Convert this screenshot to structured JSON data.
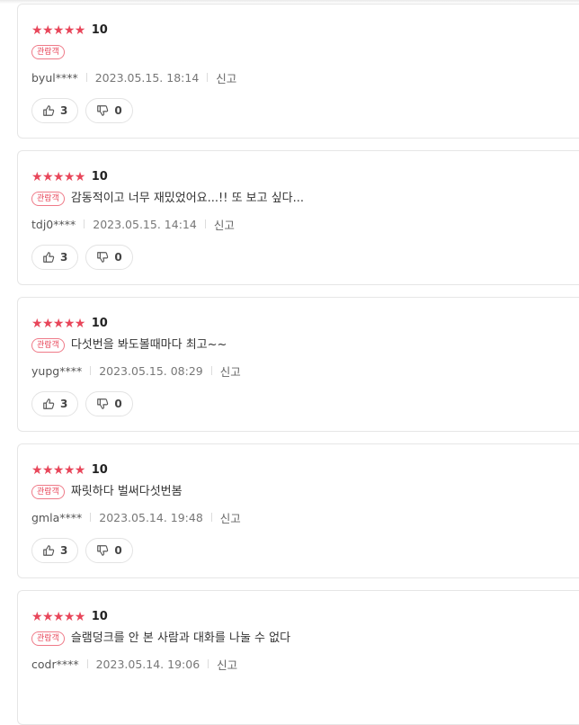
{
  "reviews": [
    {
      "stars": "★★★★★",
      "score": "10",
      "badge": "관람객",
      "comment": "",
      "user": "byul****",
      "date": "2023.05.15. 18:14",
      "report": "신고",
      "likes": "3",
      "dislikes": "0"
    },
    {
      "stars": "★★★★★",
      "score": "10",
      "badge": "관람객",
      "comment": "감동적이고 너무 재밌었어요...!! 또 보고 싶다...",
      "user": "tdj0****",
      "date": "2023.05.15. 14:14",
      "report": "신고",
      "likes": "3",
      "dislikes": "0"
    },
    {
      "stars": "★★★★★",
      "score": "10",
      "badge": "관람객",
      "comment": "다섯번을 봐도볼때마다 최고~~",
      "user": "yupg****",
      "date": "2023.05.15. 08:29",
      "report": "신고",
      "likes": "3",
      "dislikes": "0"
    },
    {
      "stars": "★★★★★",
      "score": "10",
      "badge": "관람객",
      "comment": "짜릿하다 벌써다섯번봄",
      "user": "gmla****",
      "date": "2023.05.14. 19:48",
      "report": "신고",
      "likes": "3",
      "dislikes": "0"
    },
    {
      "stars": "★★★★★",
      "score": "10",
      "badge": "관람객",
      "comment": "슬램덩크를 안 본 사람과 대화를 나눌 수 없다",
      "user": "codr****",
      "date": "2023.05.14. 19:06",
      "report": "신고",
      "likes": "",
      "dislikes": ""
    }
  ],
  "colors": {
    "accent": "#e8465a",
    "border": "#e6e6e6"
  },
  "icons": {
    "like": "thumbs-up-icon",
    "dislike": "thumbs-down-icon",
    "star": "star-icon"
  }
}
